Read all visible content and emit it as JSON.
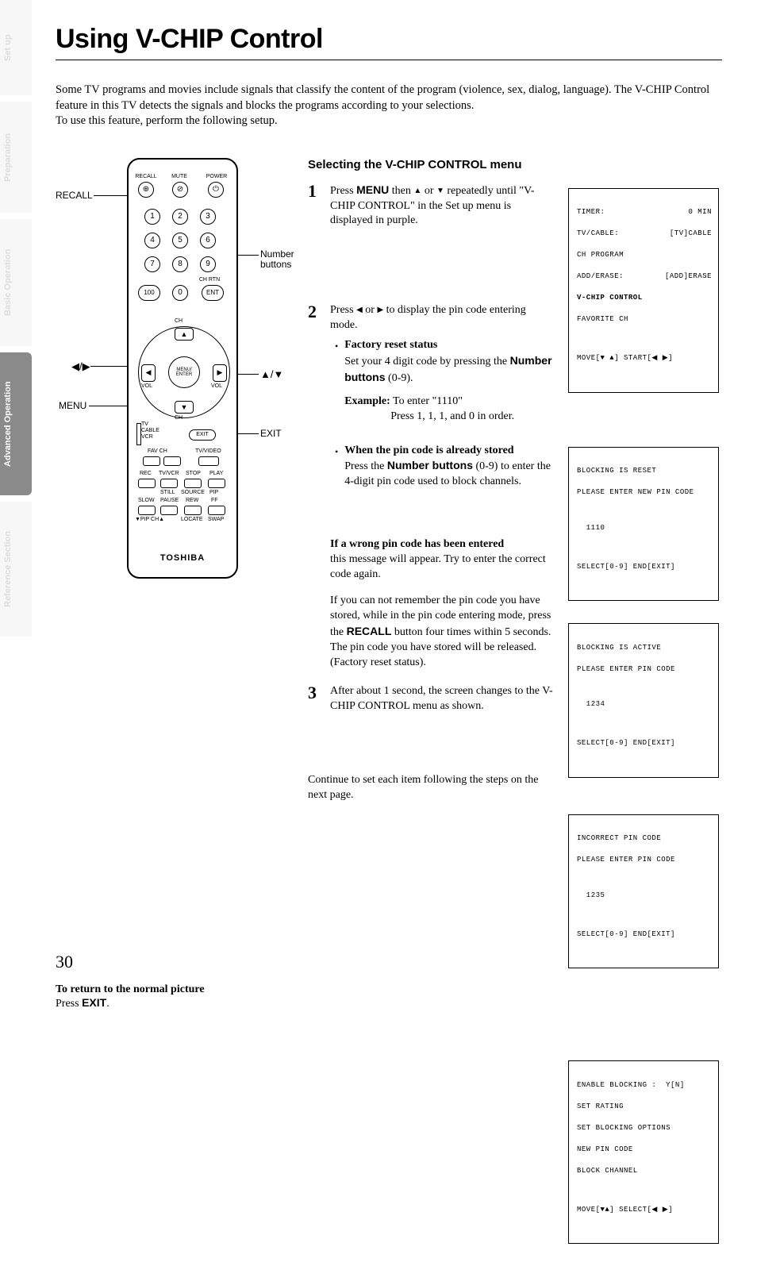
{
  "sideTabs": {
    "setup": "Set up",
    "preparation": "Preparation",
    "basic": "Basic Operation",
    "advanced": "Advanced Operation",
    "reference": "Reference Section"
  },
  "title": "Using V-CHIP Control",
  "intro": "Some TV programs and movies include signals that classify the content of the program (violence, sex, dialog, language). The V-CHIP Control feature in this TV detects the signals and blocks the programs according to your selections.\nTo use this feature, perform the following setup.",
  "remote": {
    "callouts": {
      "recall": "RECALL",
      "number": "Number buttons",
      "leftright": "◀/▶",
      "updown": "▲/▼",
      "menu": "MENU",
      "exit": "EXIT"
    },
    "labels": {
      "recall": "RECALL",
      "mute": "MUTE",
      "power": "POWER",
      "chrtn": "CH RTN",
      "ent": "ENT",
      "hundred": "100",
      "zero": "0",
      "ch": "CH",
      "vol": "VOL",
      "menuenter": "MENU/\nENTER",
      "tv": "TV",
      "cable": "CABLE",
      "vcr": "VCR",
      "exit": "EXIT",
      "favch": "FAV CH",
      "tvvideo": "TV/VIDEO",
      "rec": "REC",
      "tvvcr": "TV/VCR",
      "stop": "STOP",
      "play": "PLAY",
      "still": "STILL",
      "source": "SOURCE",
      "pip": "PIP",
      "slow": "SLOW",
      "pause": "PAUSE",
      "rew": "REW",
      "ff": "FF",
      "pipch": "▼PIP CH▲",
      "locate": "LOCATE",
      "swap": "SWAP",
      "brand": "TOSHIBA"
    }
  },
  "returnNote": {
    "heading": "To return to the normal picture",
    "press": "Press ",
    "exit": "EXIT",
    "period": "."
  },
  "subheading": "Selecting the V-CHIP CONTROL menu",
  "step1": {
    "num": "1",
    "p1a": "Press ",
    "menu": "MENU",
    "p1b": " then ",
    "up": "▲",
    "or": " or ",
    "down": "▼",
    "p1c": " repeatedly until \"V-CHIP CONTROL\" in the Set up menu is displayed in purple."
  },
  "step2": {
    "num": "2",
    "p1a": "Press ",
    "left": "◀",
    "or": " or ",
    "right": "▶",
    "p1b": " to display the pin code entering mode.",
    "bullet1": {
      "heading": "Factory reset status",
      "line1": "Set your 4 digit code by pressing the ",
      "nb": "Number buttons",
      "range": " (0-9).",
      "exampleLabel": "Example:",
      "exampleText": " To enter \"1110\"",
      "exampleLine2": "Press 1, 1, 1, and 0 in order."
    },
    "bullet2": {
      "heading": "When the pin code is already stored",
      "line1a": "Press the ",
      "nb": "Number buttons",
      "line1b": " (0-9) to enter the 4-digit pin code used to block channels."
    },
    "wrongHeading": "If a wrong pin code has been entered",
    "wrongP1": "this message will appear. Try to enter the correct code again.",
    "wrongP2a": "If you can not remember the pin code you have stored, while in the pin code entering mode, press the ",
    "recall": "RECALL",
    "wrongP2b": " button four times within 5 seconds.",
    "wrongP3": "The pin code you have stored will be released. (Factory reset status)."
  },
  "step3": {
    "num": "3",
    "text": "After about 1 second, the screen changes to the V-CHIP CONTROL menu as shown."
  },
  "continueNote": "Continue to set each item following the steps on the next page.",
  "osd1": {
    "r1a": "TIMER:",
    "r1b": "0 MIN",
    "r2a": "TV/CABLE:",
    "r2b": "[TV]CABLE",
    "r3": "CH PROGRAM",
    "r4a": "ADD/ERASE:",
    "r4b": "[ADD]ERASE",
    "r5": "V-CHIP CONTROL",
    "r6": "FAVORITE CH",
    "footer": "MOVE[▼ ▲] START[◀ ▶]"
  },
  "osd2": {
    "l1": "BLOCKING IS RESET",
    "l2": "PLEASE ENTER NEW PIN CODE",
    "code": "  1110",
    "footer": "SELECT[0-9] END[EXIT]"
  },
  "osd3": {
    "l1": "BLOCKING IS ACTIVE",
    "l2": "PLEASE ENTER PIN CODE",
    "code": "  1234",
    "footer": "SELECT[0-9] END[EXIT]"
  },
  "osd4": {
    "l1": "INCORRECT PIN CODE",
    "l2": "PLEASE ENTER PIN CODE",
    "code": "  1235",
    "footer": "SELECT[0-9] END[EXIT]"
  },
  "osd5": {
    "l1": "ENABLE BLOCKING :  Y[N]",
    "l2": "SET RATING",
    "l3": "SET BLOCKING OPTIONS",
    "l4": "NEW PIN CODE",
    "l5": "BLOCK CHANNEL",
    "footer": "MOVE[▼▲] SELECT[◀ ▶]"
  },
  "pageNum": "30"
}
